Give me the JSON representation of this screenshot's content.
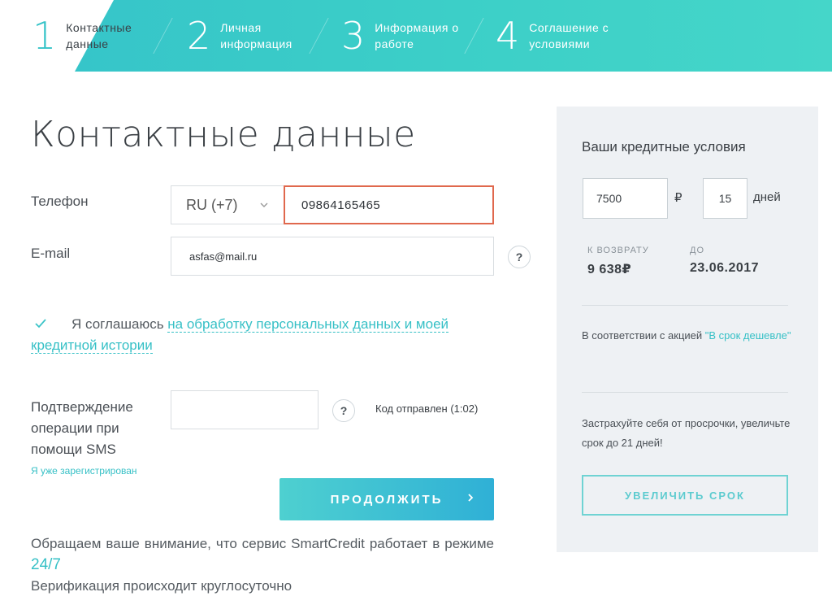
{
  "steps": [
    {
      "number": "1",
      "label": "Контактные данные"
    },
    {
      "number": "2",
      "label": "Личная информация"
    },
    {
      "number": "3",
      "label": "Информация о работе"
    },
    {
      "number": "4",
      "label": "Соглашение с условиями"
    }
  ],
  "active_step": 1,
  "form": {
    "title": "Контактные данные",
    "phone_label": "Телефон",
    "country_code": "RU (+7)",
    "phone_value": "09864165465",
    "email_label": "E-mail",
    "email_value": "asfas@mail.ru",
    "consent_text": "Я соглашаюсь ",
    "consent_link": "на обработку персональных данных и моей кредитной истории",
    "consent_checked": true,
    "sms_label": "Подтверждение операции при помощи SMS",
    "sms_value": "",
    "code_sent": "Код отправлен (1:02)",
    "registered_link": "Я уже зарегистрирован",
    "continue_button": "ПРОДОЛЖИТЬ",
    "notice_text": "Обращаем ваше внимание, что сервис SmartCredit работает в режиме ",
    "notice_highlight": "24/7",
    "notice_text2": "Верификация происходит круглосуточно",
    "help_symbol": "?"
  },
  "sidebar": {
    "title": "Ваши кредитные условия",
    "amount": "7500",
    "currency": "₽",
    "days": "15",
    "days_label": "дней",
    "return_caption": "К ВОЗВРАТУ",
    "return_value": "9 638₽",
    "until_caption": "ДО",
    "until_value": "23.06.2017",
    "promo_text": "В соответствии с акцией ",
    "promo_link": "\"В срок дешевле\"",
    "insure_text": "Застрахуйте себя от просрочки, увеличьте срок до 21 дней!",
    "extend_button": "УВЕЛИЧИТЬ СРОК"
  },
  "colors": {
    "accent": "#36c3c8",
    "error_border": "#e0684d",
    "sidebar_bg": "#eef1f4"
  }
}
